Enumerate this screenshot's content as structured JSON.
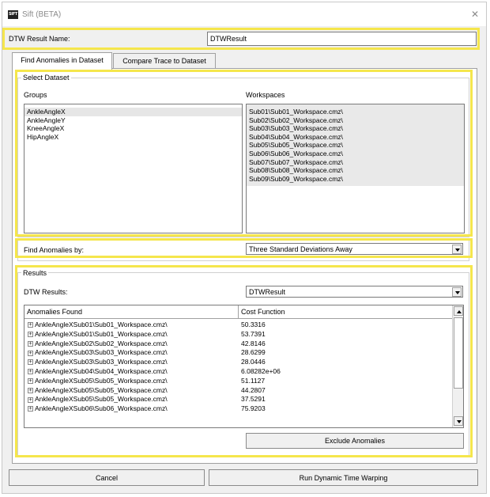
{
  "window": {
    "icon_text": "SIFT",
    "title": "Sift (BETA)",
    "close_glyph": "✕"
  },
  "name_row": {
    "label": "DTW Result Name:",
    "value": "DTWResult"
  },
  "tabs": [
    {
      "label": "Find Anomalies in Dataset",
      "active": true
    },
    {
      "label": "Compare Trace to Dataset",
      "active": false
    }
  ],
  "select_dataset": {
    "legend": "Select Dataset",
    "groups_label": "Groups",
    "workspaces_label": "Workspaces",
    "groups": [
      "AnkleAngleX",
      "AnkleAngleY",
      "KneeAngleX",
      "HipAngleX"
    ],
    "workspaces": [
      "Sub01\\Sub01_Workspace.cmz\\",
      "Sub02\\Sub02_Workspace.cmz\\",
      "Sub03\\Sub03_Workspace.cmz\\",
      "Sub04\\Sub04_Workspace.cmz\\",
      "Sub05\\Sub05_Workspace.cmz\\",
      "Sub06\\Sub06_Workspace.cmz\\",
      "Sub07\\Sub07_Workspace.cmz\\",
      "Sub08\\Sub08_Workspace.cmz\\",
      "Sub09\\Sub09_Workspace.cmz\\"
    ]
  },
  "find_by": {
    "label": "Find Anomalies by:",
    "selected": "Three Standard Deviations Away"
  },
  "results": {
    "legend": "Results",
    "dtw_label": "DTW Results:",
    "dtw_selected": "DTWResult",
    "col_anomalies": "Anomalies Found",
    "col_cost": "Cost Function",
    "rows": [
      {
        "name": "AnkleAngleXSub01\\Sub01_Workspace.cmz\\",
        "cost": "50.3316"
      },
      {
        "name": "AnkleAngleXSub01\\Sub01_Workspace.cmz\\",
        "cost": "53.7391"
      },
      {
        "name": "AnkleAngleXSub02\\Sub02_Workspace.cmz\\",
        "cost": "42.8146"
      },
      {
        "name": "AnkleAngleXSub03\\Sub03_Workspace.cmz\\",
        "cost": "28.6299"
      },
      {
        "name": "AnkleAngleXSub03\\Sub03_Workspace.cmz\\",
        "cost": "28.0446"
      },
      {
        "name": "AnkleAngleXSub04\\Sub04_Workspace.cmz\\",
        "cost": "6.08282e+06"
      },
      {
        "name": "AnkleAngleXSub05\\Sub05_Workspace.cmz\\",
        "cost": "51.1127"
      },
      {
        "name": "AnkleAngleXSub05\\Sub05_Workspace.cmz\\",
        "cost": "44.2807"
      },
      {
        "name": "AnkleAngleXSub05\\Sub05_Workspace.cmz\\",
        "cost": "37.5291"
      },
      {
        "name": "AnkleAngleXSub06\\Sub06_Workspace.cmz\\",
        "cost": "75.9203"
      }
    ],
    "expander_glyph": "+",
    "exclude_label": "Exclude Anomalies"
  },
  "footer": {
    "cancel_label": "Cancel",
    "run_label": "Run Dynamic Time Warping"
  },
  "colors": {
    "highlight": "#f5e64c",
    "window_bg": "#f0f0f0",
    "title_text": "#8a8a8a"
  }
}
